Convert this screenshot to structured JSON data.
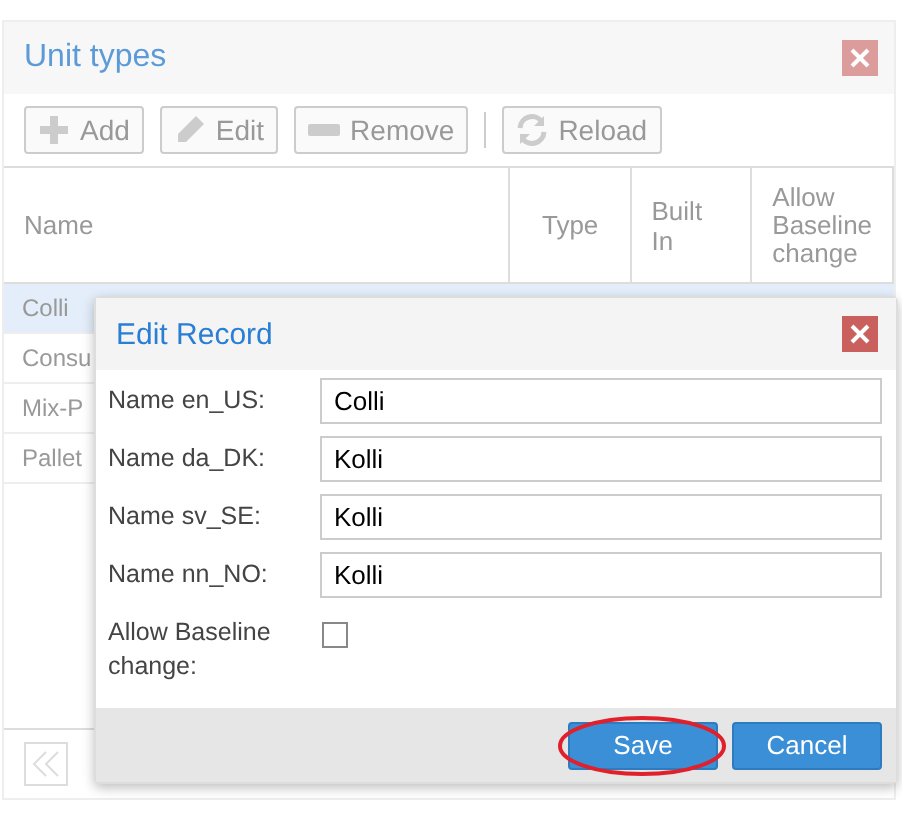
{
  "window": {
    "title": "Unit types"
  },
  "toolbar": [
    {
      "kind": "add",
      "label": "Add"
    },
    {
      "kind": "edit",
      "label": "Edit"
    },
    {
      "kind": "remove",
      "label": "Remove"
    },
    {
      "kind": "reload",
      "label": "Reload"
    }
  ],
  "table": {
    "columns": [
      "Name",
      "Type",
      "Built In",
      "Allow Baseline change"
    ],
    "rows": [
      {
        "name": "Colli",
        "selected": true
      },
      {
        "name": "Consu",
        "selected": false
      },
      {
        "name": "Mix-P",
        "selected": false
      },
      {
        "name": "Pallet",
        "selected": false
      }
    ]
  },
  "dialog": {
    "title": "Edit Record",
    "fields": [
      {
        "kind": "text",
        "label": "Name en_US:",
        "value": "Colli"
      },
      {
        "kind": "text",
        "label": "Name da_DK:",
        "value": "Kolli"
      },
      {
        "kind": "text",
        "label": "Name sv_SE:",
        "value": "Kolli"
      },
      {
        "kind": "text",
        "label": "Name nn_NO:",
        "value": "Kolli"
      },
      {
        "kind": "checkbox",
        "label": "Allow Baseline change:",
        "checked": false
      }
    ],
    "buttons": [
      {
        "label": "Save",
        "highlighted": true
      },
      {
        "label": "Cancel",
        "highlighted": false
      }
    ]
  }
}
